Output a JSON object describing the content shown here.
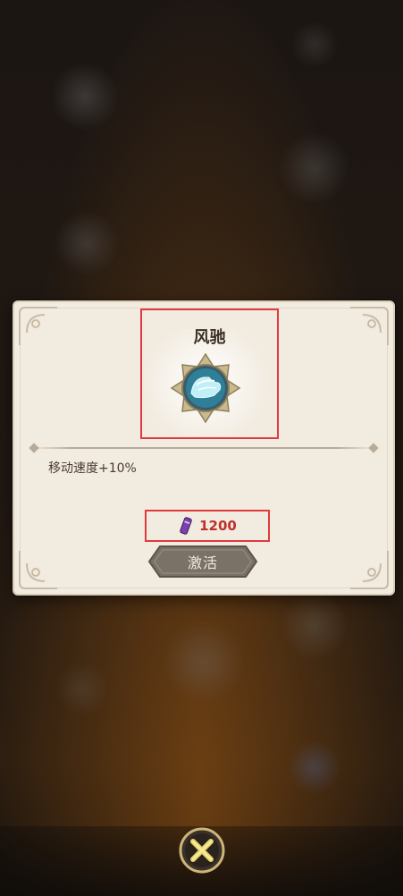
{
  "dialog": {
    "title": "风驰",
    "description": "移动速度+10%",
    "cost": {
      "value": "1200",
      "icon": "purple-scroll-icon"
    },
    "activate_label": "激活",
    "skill_icon": "winged-boot-icon"
  },
  "close_button": {
    "icon": "close-icon"
  },
  "colors": {
    "panel": "#f2ebe0",
    "highlight": "#e03a3f",
    "cost_text": "#c0302a",
    "button": "#7a7266"
  }
}
